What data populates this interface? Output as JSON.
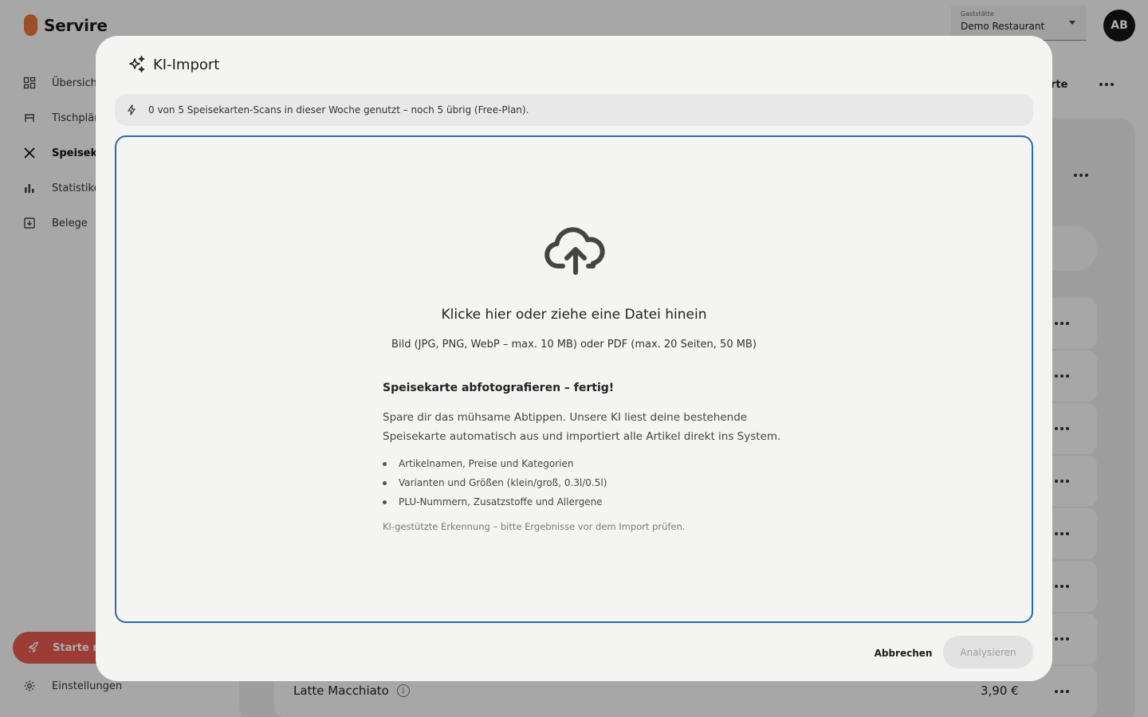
{
  "app": {
    "brand": "Servire",
    "brand_color": "#e6733b"
  },
  "sidebar": {
    "items": [
      {
        "label": "Übersicht",
        "icon": "dashboard-icon"
      },
      {
        "label": "Tischplän",
        "icon": "table-icon"
      },
      {
        "label": "Speisekar",
        "icon": "cutlery-icon",
        "active": true
      },
      {
        "label": "Statistike",
        "icon": "bar-chart-icon"
      },
      {
        "label": "Belege",
        "icon": "receipt-icon"
      }
    ],
    "promo_label": "Starte mi",
    "promo_color": "#e55a4f",
    "settings_label": "Einstellungen"
  },
  "topbar": {
    "venue_label": "Gaststätte",
    "venue_value": "Demo Restaurant",
    "avatar_initials": "AB"
  },
  "background": {
    "tab_fragment": "rte",
    "last_row": {
      "name": "Latte Macchiato",
      "price": "3,90 €"
    }
  },
  "modal": {
    "title": "KI-Import",
    "quota_text": "0 von 5 Speisekarten-Scans in dieser Woche genutzt – noch 5 übrig (Free-Plan).",
    "dropzone": {
      "title": "Klicke hier oder ziehe eine Datei hinein",
      "formats": "Bild (JPG, PNG, WebP – max. 10 MB) oder PDF (max. 20 Seiten, 50 MB)",
      "info_title": "Speisekarte abfotografieren – fertig!",
      "info_text": "Spare dir das mühsame Abtippen. Unsere KI liest deine bestehende Speisekarte automatisch aus und importiert alle Artikel direkt ins System.",
      "features": [
        "Artikelnamen, Preise und Kategorien",
        "Varianten und Größen (klein/groß, 0.3l/0.5l)",
        "PLU-Nummern, Zusatzstoffe und Allergene"
      ],
      "note": "KI-gestützte Erkennung – bitte Ergebnisse vor dem Import prüfen.",
      "border_color": "#2c6ab0"
    },
    "cancel_label": "Abbrechen",
    "analyze_label": "Analysieren",
    "analyze_disabled": true
  }
}
